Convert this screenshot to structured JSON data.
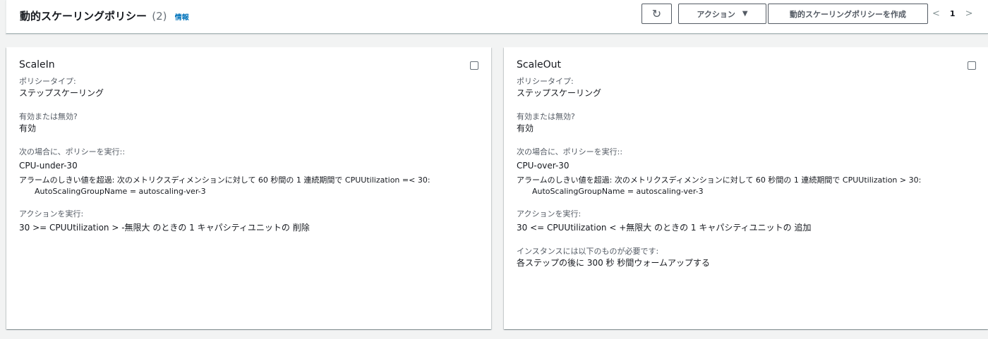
{
  "header": {
    "title": "動的スケーリングポリシー",
    "count": "(2)",
    "info": "情報",
    "refresh_glyph": "↻",
    "actions_label": "アクション",
    "actions_caret": "▼",
    "create_label": "動的スケーリングポリシーを作成",
    "prev": "<",
    "page": "1",
    "next": ">"
  },
  "labels": {
    "policy_type": "ポリシータイプ:",
    "enabled_q": "有効または無効?",
    "execute_when": "次の場合に、ポリシーを実行::",
    "take_action": "アクションを実行:",
    "instances_need": "インスタンスには以下のものが必要です:"
  },
  "policies": [
    {
      "name": "ScaleIn",
      "policy_type": "ステップスケーリング",
      "enabled": "有効",
      "alarm_name": "CPU-under-30",
      "alarm_text": "アラームのしきい値を超過: 次のメトリクスディメンションに対して 60 秒間の 1 連続期間で CPUUtilization =< 30:",
      "dimension": "AutoScalingGroupName = autoscaling-ver-3",
      "action": "30 >= CPUUtilization > -無限大 のときの 1 キャパシティユニットの 削除"
    },
    {
      "name": "ScaleOut",
      "policy_type": "ステップスケーリング",
      "enabled": "有効",
      "alarm_name": "CPU-over-30",
      "alarm_text": "アラームのしきい値を超過: 次のメトリクスディメンションに対して 60 秒間の 1 連続期間で CPUUtilization > 30:",
      "dimension": "AutoScalingGroupName = autoscaling-ver-3",
      "action": "30 <= CPUUtilization < +無限大 のときの 1 キャパシティユニットの 追加",
      "warmup": "各ステップの後に 300 秒 秒間ウォームアップする"
    }
  ]
}
